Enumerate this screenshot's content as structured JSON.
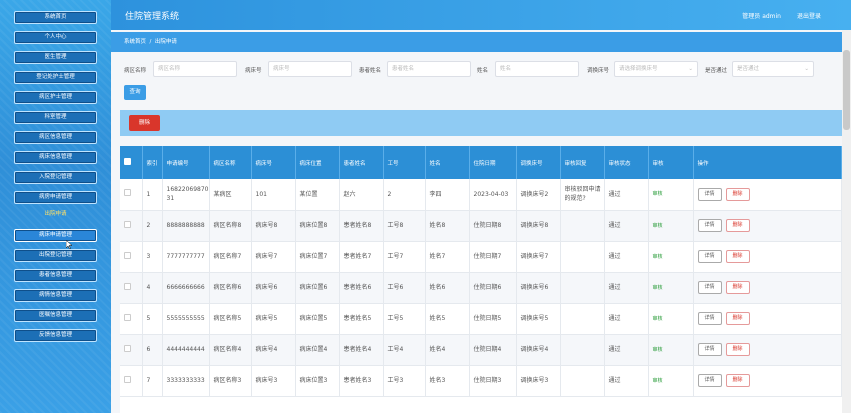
{
  "header": {
    "title": "住院管理系统",
    "user": "管理员 admin",
    "logout": "退出登录"
  },
  "breadcrumb": {
    "home": "系统首页",
    "sep": "/",
    "current": "出院申请"
  },
  "sidebar": {
    "items": [
      {
        "label": "系统首页"
      },
      {
        "label": "个人中心"
      },
      {
        "label": "医生管理"
      },
      {
        "label": "登记处护士管理"
      },
      {
        "label": "病区护士管理"
      },
      {
        "label": "科室管理"
      },
      {
        "label": "病区信息管理"
      },
      {
        "label": "病床信息管理"
      },
      {
        "label": "入院登记管理"
      },
      {
        "label": "病房申请管理"
      }
    ],
    "section": "出院申请",
    "items2": [
      {
        "label": "病床申请管理"
      },
      {
        "label": "出院登记管理"
      },
      {
        "label": "患者信息管理"
      },
      {
        "label": "病情信息管理"
      },
      {
        "label": "医嘱信息管理"
      },
      {
        "label": "反馈信息管理"
      }
    ]
  },
  "search": {
    "fields": [
      {
        "label": "病区名称",
        "placeholder": "病区名称"
      },
      {
        "label": "病床号",
        "placeholder": "病床号"
      },
      {
        "label": "患者姓名",
        "placeholder": "患者姓名"
      },
      {
        "label": "姓名",
        "placeholder": "姓名"
      },
      {
        "label": "调换床号",
        "placeholder": "请选择调换床号"
      },
      {
        "label": "是否通过",
        "placeholder": "是否通过"
      }
    ],
    "query_label": "查询"
  },
  "toolbar": {
    "delete_label": "删除"
  },
  "table": {
    "headers": [
      "",
      "索引",
      "申请编号",
      "病区名称",
      "病床号",
      "病床位置",
      "患者姓名",
      "工号",
      "姓名",
      "住院日期",
      "调换床号",
      "审核回复",
      "审核状态",
      "审核",
      "操作"
    ],
    "rows": [
      [
        "1",
        "1682206987031",
        "某病区",
        "101",
        "某位置",
        "赵六",
        "2",
        "李四",
        "2023-04-03",
        "调换床号2",
        "审核驳回申请的规范?",
        "通过"
      ],
      [
        "2",
        "8888888888",
        "病区名称8",
        "病床号8",
        "病床位置8",
        "患者姓名8",
        "工号8",
        "姓名8",
        "住院日期8",
        "调换床号8",
        "",
        "通过"
      ],
      [
        "3",
        "7777777777",
        "病区名称7",
        "病床号7",
        "病床位置7",
        "患者姓名7",
        "工号7",
        "姓名7",
        "住院日期7",
        "调换床号7",
        "",
        "通过"
      ],
      [
        "4",
        "6666666666",
        "病区名称6",
        "病床号6",
        "病床位置6",
        "患者姓名6",
        "工号6",
        "姓名6",
        "住院日期6",
        "调换床号6",
        "",
        "通过"
      ],
      [
        "5",
        "5555555555",
        "病区名称5",
        "病床号5",
        "病床位置5",
        "患者姓名5",
        "工号5",
        "姓名5",
        "住院日期5",
        "调换床号5",
        "",
        "通过"
      ],
      [
        "6",
        "4444444444",
        "病区名称4",
        "病床号4",
        "病床位置4",
        "患者姓名4",
        "工号4",
        "姓名4",
        "住院日期4",
        "调换床号4",
        "",
        "通过"
      ],
      [
        "7",
        "3333333333",
        "病区名称3",
        "病床号3",
        "病床位置3",
        "患者姓名3",
        "工号3",
        "姓名3",
        "住院日期3",
        "调换床号3",
        "",
        "通过"
      ]
    ],
    "audit_label": "审核",
    "detail_label": "详情",
    "delete_label": "删除"
  },
  "colors": {
    "primary": "#2c8fd6",
    "danger": "#d9362b",
    "sidebar": "#1c6fb6"
  }
}
